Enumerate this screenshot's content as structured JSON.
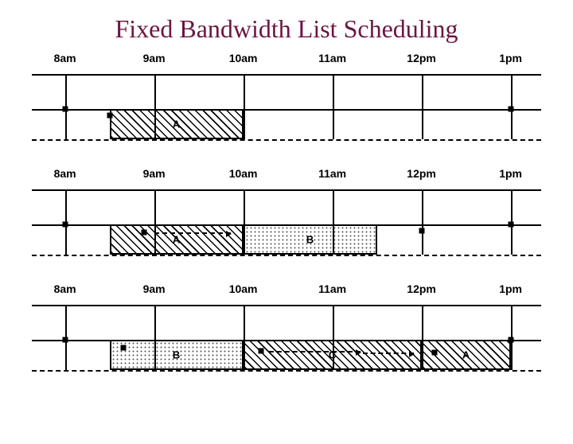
{
  "title": "Fixed Bandwidth List Scheduling",
  "chart_data": [
    {
      "type": "bar",
      "categories": [
        "8am",
        "9am",
        "10am",
        "11am",
        "12pm",
        "1pm"
      ],
      "title": "",
      "series": [
        {
          "name": "A",
          "start": "8:30",
          "end": "10am",
          "pattern": "hatch"
        }
      ]
    },
    {
      "type": "bar",
      "categories": [
        "8am",
        "9am",
        "10am",
        "11am",
        "12pm",
        "1pm"
      ],
      "title": "",
      "series": [
        {
          "name": "A",
          "start": "8:30",
          "end": "10am",
          "pattern": "hatch"
        },
        {
          "name": "B",
          "start": "10am",
          "end": "11:30",
          "pattern": "dots"
        }
      ]
    },
    {
      "type": "bar",
      "categories": [
        "8am",
        "9am",
        "10am",
        "11am",
        "12pm",
        "1pm"
      ],
      "title": "",
      "series": [
        {
          "name": "B",
          "start": "8:30",
          "end": "10am",
          "pattern": "dots"
        },
        {
          "name": "C",
          "start": "10am",
          "end": "12pm",
          "pattern": "hatch"
        },
        {
          "name": "A",
          "start": "12pm",
          "end": "1pm",
          "pattern": "hatch"
        }
      ]
    }
  ]
}
